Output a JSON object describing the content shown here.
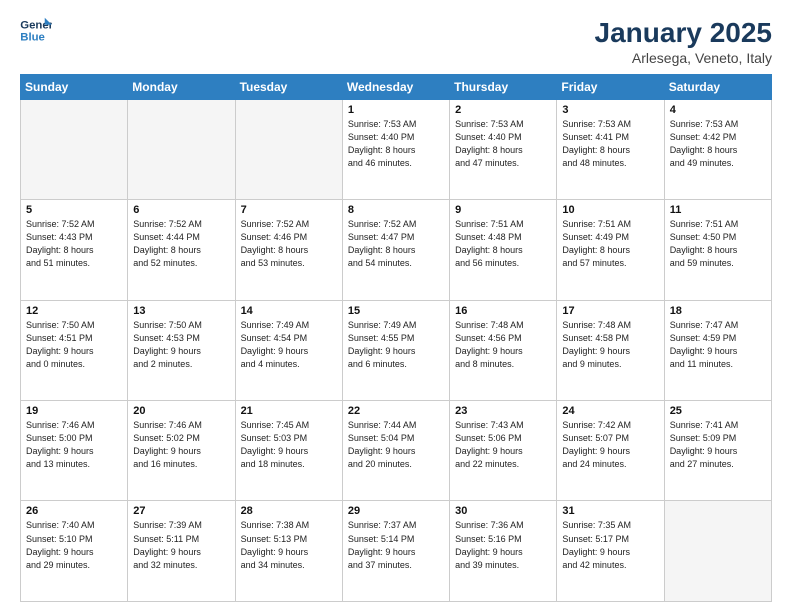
{
  "logo": {
    "line1": "General",
    "line2": "Blue"
  },
  "title": "January 2025",
  "subtitle": "Arlesega, Veneto, Italy",
  "weekdays": [
    "Sunday",
    "Monday",
    "Tuesday",
    "Wednesday",
    "Thursday",
    "Friday",
    "Saturday"
  ],
  "weeks": [
    [
      {
        "day": "",
        "info": ""
      },
      {
        "day": "",
        "info": ""
      },
      {
        "day": "",
        "info": ""
      },
      {
        "day": "1",
        "info": "Sunrise: 7:53 AM\nSunset: 4:40 PM\nDaylight: 8 hours\nand 46 minutes."
      },
      {
        "day": "2",
        "info": "Sunrise: 7:53 AM\nSunset: 4:40 PM\nDaylight: 8 hours\nand 47 minutes."
      },
      {
        "day": "3",
        "info": "Sunrise: 7:53 AM\nSunset: 4:41 PM\nDaylight: 8 hours\nand 48 minutes."
      },
      {
        "day": "4",
        "info": "Sunrise: 7:53 AM\nSunset: 4:42 PM\nDaylight: 8 hours\nand 49 minutes."
      }
    ],
    [
      {
        "day": "5",
        "info": "Sunrise: 7:52 AM\nSunset: 4:43 PM\nDaylight: 8 hours\nand 51 minutes."
      },
      {
        "day": "6",
        "info": "Sunrise: 7:52 AM\nSunset: 4:44 PM\nDaylight: 8 hours\nand 52 minutes."
      },
      {
        "day": "7",
        "info": "Sunrise: 7:52 AM\nSunset: 4:46 PM\nDaylight: 8 hours\nand 53 minutes."
      },
      {
        "day": "8",
        "info": "Sunrise: 7:52 AM\nSunset: 4:47 PM\nDaylight: 8 hours\nand 54 minutes."
      },
      {
        "day": "9",
        "info": "Sunrise: 7:51 AM\nSunset: 4:48 PM\nDaylight: 8 hours\nand 56 minutes."
      },
      {
        "day": "10",
        "info": "Sunrise: 7:51 AM\nSunset: 4:49 PM\nDaylight: 8 hours\nand 57 minutes."
      },
      {
        "day": "11",
        "info": "Sunrise: 7:51 AM\nSunset: 4:50 PM\nDaylight: 8 hours\nand 59 minutes."
      }
    ],
    [
      {
        "day": "12",
        "info": "Sunrise: 7:50 AM\nSunset: 4:51 PM\nDaylight: 9 hours\nand 0 minutes."
      },
      {
        "day": "13",
        "info": "Sunrise: 7:50 AM\nSunset: 4:53 PM\nDaylight: 9 hours\nand 2 minutes."
      },
      {
        "day": "14",
        "info": "Sunrise: 7:49 AM\nSunset: 4:54 PM\nDaylight: 9 hours\nand 4 minutes."
      },
      {
        "day": "15",
        "info": "Sunrise: 7:49 AM\nSunset: 4:55 PM\nDaylight: 9 hours\nand 6 minutes."
      },
      {
        "day": "16",
        "info": "Sunrise: 7:48 AM\nSunset: 4:56 PM\nDaylight: 9 hours\nand 8 minutes."
      },
      {
        "day": "17",
        "info": "Sunrise: 7:48 AM\nSunset: 4:58 PM\nDaylight: 9 hours\nand 9 minutes."
      },
      {
        "day": "18",
        "info": "Sunrise: 7:47 AM\nSunset: 4:59 PM\nDaylight: 9 hours\nand 11 minutes."
      }
    ],
    [
      {
        "day": "19",
        "info": "Sunrise: 7:46 AM\nSunset: 5:00 PM\nDaylight: 9 hours\nand 13 minutes."
      },
      {
        "day": "20",
        "info": "Sunrise: 7:46 AM\nSunset: 5:02 PM\nDaylight: 9 hours\nand 16 minutes."
      },
      {
        "day": "21",
        "info": "Sunrise: 7:45 AM\nSunset: 5:03 PM\nDaylight: 9 hours\nand 18 minutes."
      },
      {
        "day": "22",
        "info": "Sunrise: 7:44 AM\nSunset: 5:04 PM\nDaylight: 9 hours\nand 20 minutes."
      },
      {
        "day": "23",
        "info": "Sunrise: 7:43 AM\nSunset: 5:06 PM\nDaylight: 9 hours\nand 22 minutes."
      },
      {
        "day": "24",
        "info": "Sunrise: 7:42 AM\nSunset: 5:07 PM\nDaylight: 9 hours\nand 24 minutes."
      },
      {
        "day": "25",
        "info": "Sunrise: 7:41 AM\nSunset: 5:09 PM\nDaylight: 9 hours\nand 27 minutes."
      }
    ],
    [
      {
        "day": "26",
        "info": "Sunrise: 7:40 AM\nSunset: 5:10 PM\nDaylight: 9 hours\nand 29 minutes."
      },
      {
        "day": "27",
        "info": "Sunrise: 7:39 AM\nSunset: 5:11 PM\nDaylight: 9 hours\nand 32 minutes."
      },
      {
        "day": "28",
        "info": "Sunrise: 7:38 AM\nSunset: 5:13 PM\nDaylight: 9 hours\nand 34 minutes."
      },
      {
        "day": "29",
        "info": "Sunrise: 7:37 AM\nSunset: 5:14 PM\nDaylight: 9 hours\nand 37 minutes."
      },
      {
        "day": "30",
        "info": "Sunrise: 7:36 AM\nSunset: 5:16 PM\nDaylight: 9 hours\nand 39 minutes."
      },
      {
        "day": "31",
        "info": "Sunrise: 7:35 AM\nSunset: 5:17 PM\nDaylight: 9 hours\nand 42 minutes."
      },
      {
        "day": "",
        "info": ""
      }
    ]
  ]
}
